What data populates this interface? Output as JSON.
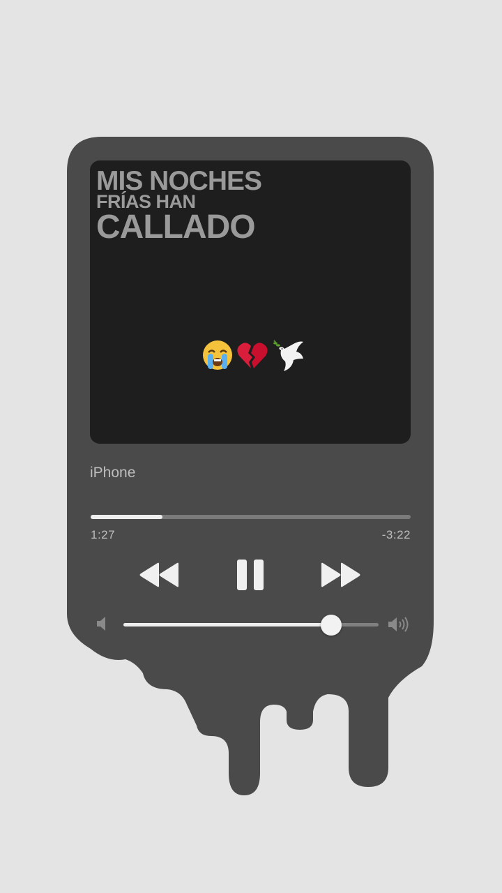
{
  "colors": {
    "page_background": "#e4e4e4",
    "player_body": "#4a4a4a",
    "artwork_background": "#1e1e1e",
    "lyric_text": "#9a9a9a"
  },
  "artwork": {
    "lyrics": [
      "MIS NOCHES",
      "FRÍAS HAN",
      "CALLADO"
    ],
    "emojis": [
      "loudly-crying-face",
      "broken-heart",
      "dove"
    ]
  },
  "device": {
    "label": "iPhone"
  },
  "playback": {
    "elapsed": "1:27",
    "remaining": "-3:22",
    "progress_fraction": 0.225,
    "state": "playing"
  },
  "controls": {
    "rewind_icon": "rewind-icon",
    "pause_icon": "pause-icon",
    "forward_icon": "fast-forward-icon"
  },
  "volume": {
    "level_fraction": 0.815,
    "low_icon": "volume-low-icon",
    "high_icon": "volume-high-icon"
  }
}
